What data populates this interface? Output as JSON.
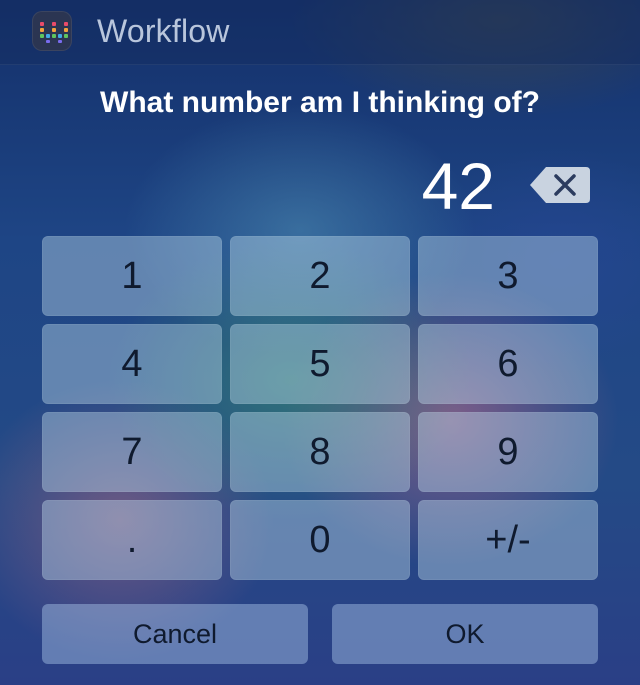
{
  "header": {
    "app_title": "Workflow",
    "app_icon": "workflow-app-icon"
  },
  "prompt": {
    "text": "What number am I thinking of?"
  },
  "display": {
    "value": "42",
    "backspace_icon": "backspace-icon"
  },
  "keypad": {
    "keys": [
      "1",
      "2",
      "3",
      "4",
      "5",
      "6",
      "7",
      "8",
      "9",
      ".",
      "0",
      "+/-"
    ]
  },
  "actions": {
    "cancel_label": "Cancel",
    "ok_label": "OK"
  },
  "colors": {
    "key_fill": "#bedceb",
    "text_dark": "#0f1a2e",
    "text_light": "#ffffff",
    "header_title": "#b9c6dc"
  }
}
